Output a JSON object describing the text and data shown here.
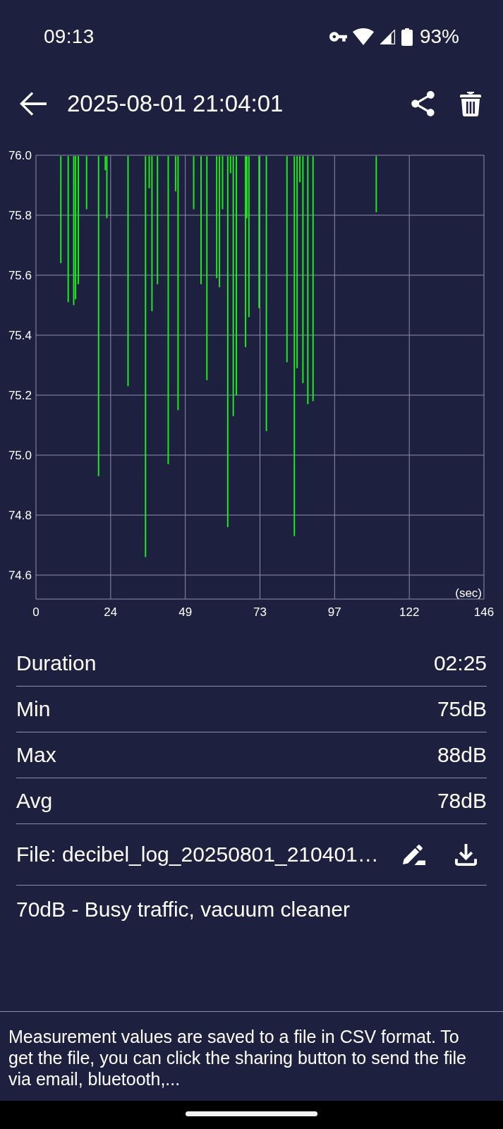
{
  "status_bar": {
    "time": "09:13",
    "battery": "93%"
  },
  "header": {
    "title": "2025-08-01 21:04:01"
  },
  "chart": {
    "chart_data": {
      "type": "line",
      "xlabel": "(sec)",
      "grid": true,
      "xlim": [
        0,
        146
      ],
      "ylim": [
        74.52,
        76
      ],
      "xticks": [
        {
          "value": 0,
          "label": "0"
        },
        {
          "value": 24.33,
          "label": "24"
        },
        {
          "value": 48.67,
          "label": "49"
        },
        {
          "value": 73,
          "label": "73"
        },
        {
          "value": 97.33,
          "label": "97"
        },
        {
          "value": 121.67,
          "label": "122"
        },
        {
          "value": 146,
          "label": "146"
        }
      ],
      "yticks": [
        {
          "value": 74.6,
          "label": "74.6"
        },
        {
          "value": 74.8,
          "label": "74.8"
        },
        {
          "value": 75,
          "label": "75.0"
        },
        {
          "value": 75.2,
          "label": "75.2"
        },
        {
          "value": 75.4,
          "label": "75.4"
        },
        {
          "value": 75.6,
          "label": "75.6"
        },
        {
          "value": 75.8,
          "label": "75.8"
        },
        {
          "value": 76,
          "label": "76.0"
        }
      ],
      "x": [
        8.1,
        8.1,
        8.1,
        10.5,
        10.5,
        10.5,
        12.3,
        12.3,
        12.3,
        12.9,
        12.9,
        12.9,
        13.8,
        13.8,
        13.8,
        16.5,
        16.5,
        16.5,
        20.4,
        20.4,
        20.4,
        22.6,
        22.6,
        22.6,
        23.1,
        23.1,
        23.1,
        30.0,
        30.0,
        30.0,
        35.7,
        35.7,
        35.7,
        36.9,
        36.9,
        36.9,
        37.8,
        37.8,
        37.8,
        39.6,
        39.6,
        39.6,
        43.1,
        43.1,
        43.1,
        45.5,
        45.5,
        45.5,
        46.3,
        46.3,
        46.3,
        51.4,
        51.4,
        51.4,
        53.8,
        53.8,
        53.8,
        55.7,
        55.7,
        55.7,
        58.9,
        58.9,
        58.9,
        59.8,
        59.8,
        59.8,
        60.8,
        60.8,
        60.8,
        62.5,
        62.5,
        62.5,
        63.4,
        63.4,
        63.4,
        64.3,
        64.3,
        64.3,
        65.3,
        65.3,
        65.3,
        68.3,
        68.3,
        68.3,
        68.7,
        68.7,
        68.7,
        69.4,
        69.4,
        69.4,
        72.7,
        72.7,
        72.7,
        75.1,
        75.1,
        75.1,
        81.8,
        81.8,
        81.8,
        84.2,
        84.2,
        84.2,
        85.1,
        85.1,
        85.1,
        86.0,
        86.0,
        86.0,
        87.0,
        87.0,
        87.0,
        88.6,
        88.6,
        88.6,
        90.3,
        90.3,
        90.3,
        110.9,
        110.9,
        110.9
      ],
      "series": [
        {
          "color": "#1ee81e",
          "values": [
            76,
            75.64,
            76,
            76,
            75.51,
            76,
            76,
            75.5,
            76,
            76,
            75.52,
            76,
            76,
            75.57,
            76,
            76,
            75.82,
            76,
            76,
            74.93,
            76,
            76,
            75.95,
            76,
            76,
            75.79,
            76,
            76,
            75.23,
            76,
            76,
            74.66,
            76,
            76,
            75.89,
            76,
            76,
            75.48,
            76,
            76,
            75.57,
            76,
            76,
            74.97,
            76,
            76,
            75.88,
            76,
            76,
            75.15,
            76,
            76,
            75.82,
            76,
            76,
            75.57,
            76,
            76,
            75.25,
            76,
            76,
            75.59,
            76,
            76,
            75.56,
            76,
            76,
            75.82,
            76,
            76,
            74.76,
            76,
            76,
            75.94,
            76,
            76,
            75.13,
            76,
            76,
            75.2,
            76,
            76,
            75.36,
            76,
            76,
            75.79,
            76,
            76,
            75.46,
            76,
            76,
            75.49,
            76,
            76,
            75.08,
            76,
            76,
            75.31,
            76,
            76,
            74.73,
            76,
            76,
            75.29,
            76,
            76,
            75.91,
            76,
            76,
            75.24,
            76,
            76,
            75.17,
            76,
            76,
            75.18,
            76,
            76,
            75.81,
            76
          ]
        }
      ]
    }
  },
  "stats": [
    {
      "label": "Duration",
      "value": "02:25"
    },
    {
      "label": "Min",
      "value": "75dB"
    },
    {
      "label": "Max",
      "value": "88dB"
    },
    {
      "label": "Avg",
      "value": "78dB"
    }
  ],
  "file": {
    "name": "File: decibel_log_20250801_210401…"
  },
  "noise_reference": "70dB - Busy traffic, vacuum cleaner",
  "info_text": "Measurement values are saved to a file in CSV format. To get the file, you can click the sharing button to send the file via email, bluetooth,..."
}
